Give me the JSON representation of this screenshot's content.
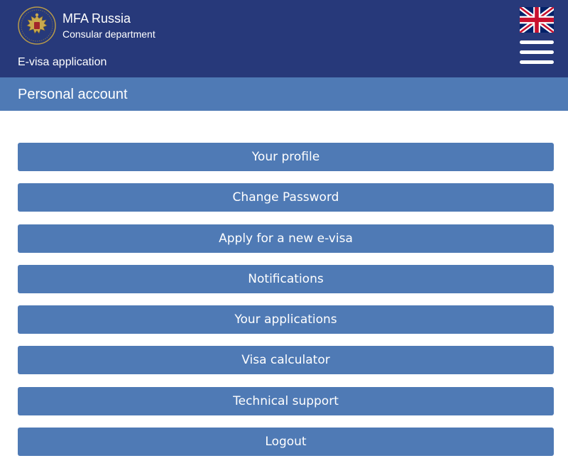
{
  "header": {
    "org_name": "MFA Russia",
    "org_dept": "Consular department",
    "app_name": "E-visa application",
    "emblem_icon": "coat-of-arms-icon",
    "language_icon": "uk-flag-icon",
    "menu_icon": "hamburger-menu-icon"
  },
  "page": {
    "title": "Personal account"
  },
  "menu": {
    "items": [
      {
        "label": "Your profile"
      },
      {
        "label": "Change Password"
      },
      {
        "label": "Apply for a new e-visa"
      },
      {
        "label": "Notifications"
      },
      {
        "label": "Your applications"
      },
      {
        "label": "Visa calculator"
      },
      {
        "label": "Technical support"
      },
      {
        "label": "Logout"
      }
    ]
  },
  "colors": {
    "header_bg": "#27397a",
    "accent": "#4f7ab5",
    "text_on_accent": "#ffffff"
  }
}
